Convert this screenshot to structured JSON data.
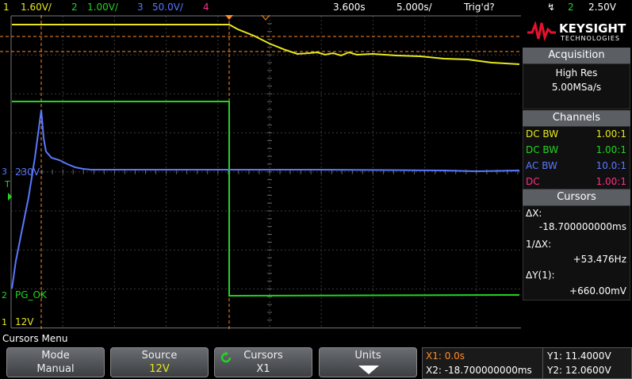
{
  "topbar": {
    "ch1_num": "1",
    "ch1_scale": "1.60V/",
    "ch2_num": "2",
    "ch2_scale": "1.00V/",
    "ch3_num": "3",
    "ch3_scale": "50.0V/",
    "ch4_num": "4",
    "time_pos": "3.600s",
    "time_scale": "5.000s/",
    "trig_status": "Trig'd?",
    "trig_icon": "↯",
    "trig_channel": "2",
    "trig_level": "2.50V"
  },
  "scope": {
    "ch3_label": "230V",
    "ch2_label": "PG_OK",
    "ch1_label": "12V",
    "ch3_marker": "3",
    "ch2_marker": "2",
    "ch1_marker": "1",
    "trigger_marker": "T"
  },
  "panel": {
    "brand": "KEYSIGHT",
    "brand_sub": "TECHNOLOGIES",
    "acq_header": "Acquisition",
    "acq_mode": "High Res",
    "acq_rate": "5.00MSa/s",
    "chan_header": "Channels",
    "channels": [
      {
        "coupling": "DC BW",
        "ratio": "1.00:1",
        "color": "#e8e81c"
      },
      {
        "coupling": "DC BW",
        "ratio": "1.00:1",
        "color": "#22d422"
      },
      {
        "coupling": "AC BW",
        "ratio": "10.0:1",
        "color": "#5a78ff"
      },
      {
        "coupling": "DC",
        "ratio": "1.00:1",
        "color": "#ff2e8a"
      }
    ],
    "cursors_header": "Cursors",
    "dx_label": "ΔX:",
    "dx_value": "-18.700000000ms",
    "inv_dx_label": "1/ΔX:",
    "inv_dx_value": "+53.476Hz",
    "dy_label": "ΔY(1):",
    "dy_value": "+660.00mV"
  },
  "menu": {
    "title": "Cursors Menu",
    "keys": [
      {
        "top": "Mode",
        "bottom": "Manual"
      },
      {
        "top": "Source",
        "bottom": "12V"
      },
      {
        "top": "Cursors",
        "bottom": "X1"
      },
      {
        "top": "Units",
        "bottom": ""
      }
    ]
  },
  "readout": {
    "x1": "X1: 0.0s",
    "x2": "X2: -18.700000000ms",
    "y1": "Y1: 11.4000V",
    "y2": "Y2: 12.0600V"
  },
  "colors": {
    "ch1": "#e8e81c",
    "ch2": "#22d422",
    "ch3": "#5a78ff",
    "ch4": "#ff2e8a",
    "cursor": "#ff8c28",
    "grid": "#444444"
  }
}
